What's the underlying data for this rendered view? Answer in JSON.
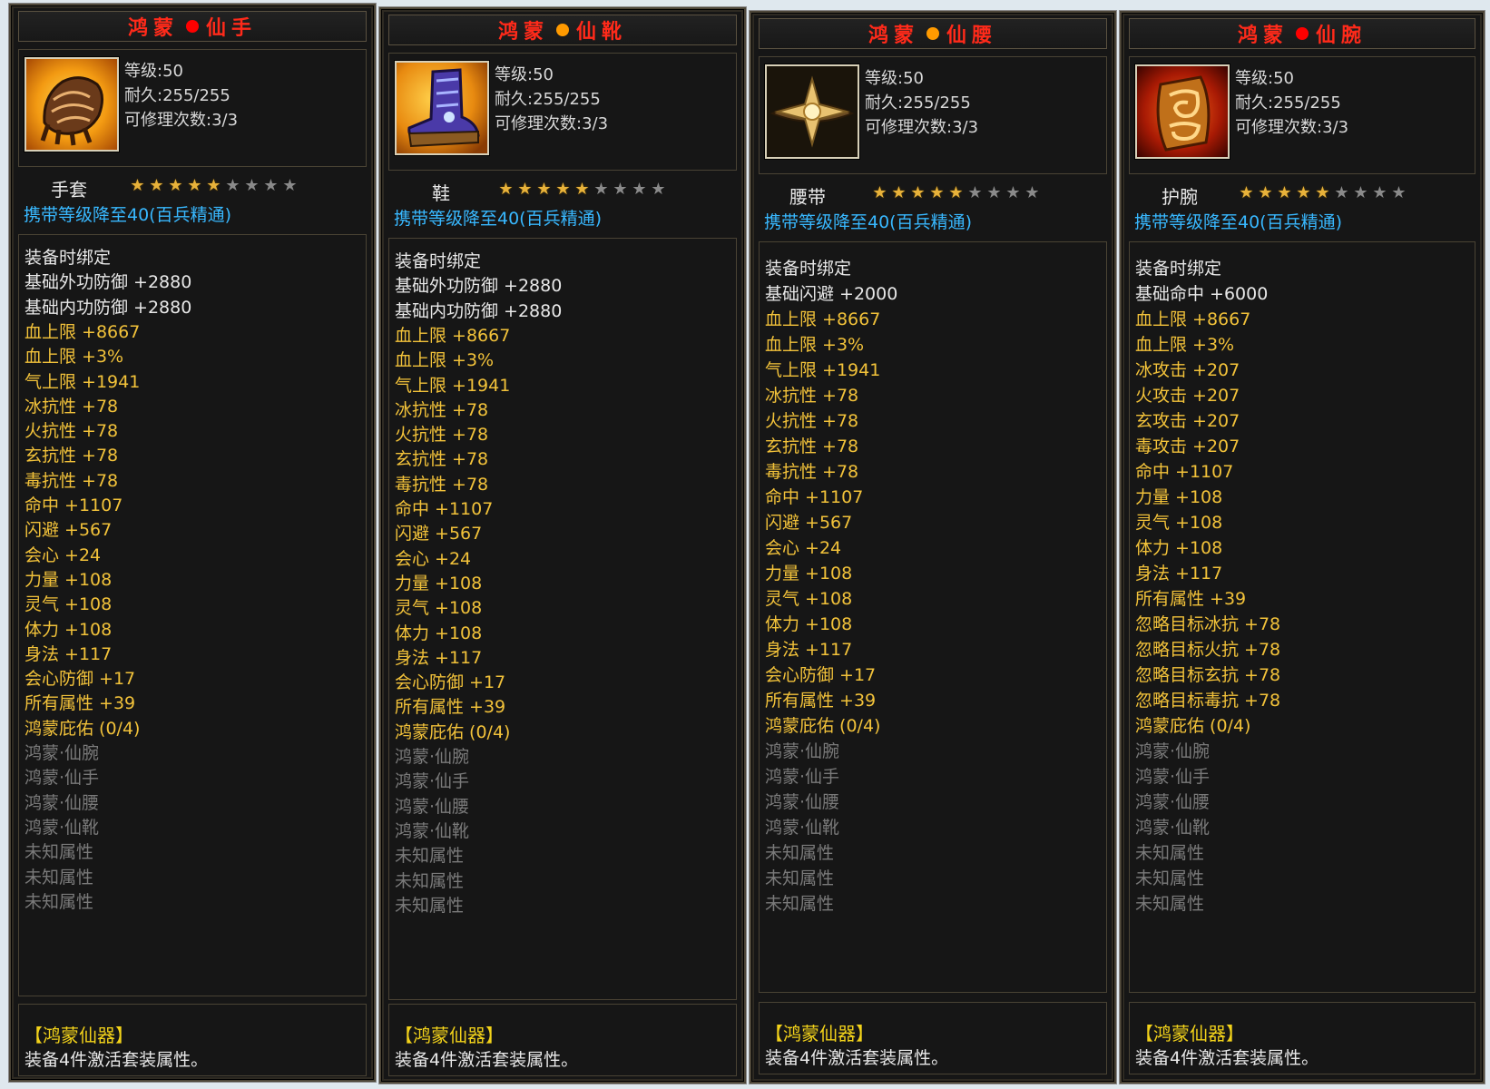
{
  "colors": {
    "title": "#ff2a1a",
    "dot": "#ff0000",
    "dot_boots": "#ff9a00",
    "carry": "#38b8ff",
    "gold": "#f2c23a",
    "inactive": "#7a7a7a",
    "star_on": "#e8b23a",
    "star_off": "#8a8a8a"
  },
  "stars_total": 9,
  "panels": [
    {
      "title_left": "鸿蒙",
      "title_right": "仙手",
      "icon": "gauntlet-icon",
      "level": "等级:50",
      "durability": "耐久:255/255",
      "repair": "可修理次数:3/3",
      "type": "手套",
      "stars_filled": 5,
      "carry": "携带等级降至40(百兵精通)",
      "bind": "装备时绑定",
      "stats": [
        {
          "t": "基础外功防御 +2880",
          "c": "white"
        },
        {
          "t": "基础内功防御 +2880",
          "c": "white"
        },
        {
          "t": "血上限 +8667",
          "c": "gold"
        },
        {
          "t": "血上限 +3%",
          "c": "gold"
        },
        {
          "t": "气上限 +1941",
          "c": "gold"
        },
        {
          "t": "冰抗性 +78",
          "c": "gold"
        },
        {
          "t": "火抗性 +78",
          "c": "gold"
        },
        {
          "t": "玄抗性 +78",
          "c": "gold"
        },
        {
          "t": "毒抗性 +78",
          "c": "gold"
        },
        {
          "t": "命中 +1107",
          "c": "gold"
        },
        {
          "t": "闪避 +567",
          "c": "gold"
        },
        {
          "t": "会心 +24",
          "c": "gold"
        },
        {
          "t": "力量 +108",
          "c": "gold"
        },
        {
          "t": "灵气 +108",
          "c": "gold"
        },
        {
          "t": "体力 +108",
          "c": "gold"
        },
        {
          "t": "身法 +117",
          "c": "gold"
        },
        {
          "t": "会心防御 +17",
          "c": "gold"
        },
        {
          "t": "所有属性 +39",
          "c": "gold"
        },
        {
          "t": "鸿蒙庇佑 (0/4)",
          "c": "gold"
        },
        {
          "t": "鸿蒙·仙腕",
          "c": "gray"
        },
        {
          "t": "鸿蒙·仙手",
          "c": "gray"
        },
        {
          "t": "鸿蒙·仙腰",
          "c": "gray"
        },
        {
          "t": "鸿蒙·仙靴",
          "c": "gray"
        },
        {
          "t": "未知属性",
          "c": "gray"
        },
        {
          "t": "未知属性",
          "c": "gray"
        },
        {
          "t": "未知属性",
          "c": "gray"
        }
      ],
      "set_name": "【鸿蒙仙器】",
      "set_desc": "装备4件激活套装属性。"
    },
    {
      "title_left": "鸿蒙",
      "title_right": "仙靴",
      "icon": "boots-icon",
      "level": "等级:50",
      "durability": "耐久:255/255",
      "repair": "可修理次数:3/3",
      "type": "鞋",
      "stars_filled": 5,
      "carry": "携带等级降至40(百兵精通)",
      "bind": "装备时绑定",
      "stats": [
        {
          "t": "基础外功防御 +2880",
          "c": "white"
        },
        {
          "t": "基础内功防御 +2880",
          "c": "white"
        },
        {
          "t": "血上限 +8667",
          "c": "gold"
        },
        {
          "t": "血上限 +3%",
          "c": "gold"
        },
        {
          "t": "气上限 +1941",
          "c": "gold"
        },
        {
          "t": "冰抗性 +78",
          "c": "gold"
        },
        {
          "t": "火抗性 +78",
          "c": "gold"
        },
        {
          "t": "玄抗性 +78",
          "c": "gold"
        },
        {
          "t": "毒抗性 +78",
          "c": "gold"
        },
        {
          "t": "命中 +1107",
          "c": "gold"
        },
        {
          "t": "闪避 +567",
          "c": "gold"
        },
        {
          "t": "会心 +24",
          "c": "gold"
        },
        {
          "t": "力量 +108",
          "c": "gold"
        },
        {
          "t": "灵气 +108",
          "c": "gold"
        },
        {
          "t": "体力 +108",
          "c": "gold"
        },
        {
          "t": "身法 +117",
          "c": "gold"
        },
        {
          "t": "会心防御 +17",
          "c": "gold"
        },
        {
          "t": "所有属性 +39",
          "c": "gold"
        },
        {
          "t": "鸿蒙庇佑 (0/4)",
          "c": "gold"
        },
        {
          "t": "鸿蒙·仙腕",
          "c": "gray"
        },
        {
          "t": "鸿蒙·仙手",
          "c": "gray"
        },
        {
          "t": "鸿蒙·仙腰",
          "c": "gray"
        },
        {
          "t": "鸿蒙·仙靴",
          "c": "gray"
        },
        {
          "t": "未知属性",
          "c": "gray"
        },
        {
          "t": "未知属性",
          "c": "gray"
        },
        {
          "t": "未知属性",
          "c": "gray"
        }
      ],
      "set_name": "【鸿蒙仙器】",
      "set_desc": "装备4件激活套装属性。"
    },
    {
      "title_left": "鸿蒙",
      "title_right": "仙腰",
      "icon": "belt-icon",
      "level": "等级:50",
      "durability": "耐久:255/255",
      "repair": "可修理次数:3/3",
      "type": "腰带",
      "stars_filled": 5,
      "carry": "携带等级降至40(百兵精通)",
      "bind": "装备时绑定",
      "stats": [
        {
          "t": "基础闪避 +2000",
          "c": "white"
        },
        {
          "t": "血上限 +8667",
          "c": "gold"
        },
        {
          "t": "血上限 +3%",
          "c": "gold"
        },
        {
          "t": "气上限 +1941",
          "c": "gold"
        },
        {
          "t": "冰抗性 +78",
          "c": "gold"
        },
        {
          "t": "火抗性 +78",
          "c": "gold"
        },
        {
          "t": "玄抗性 +78",
          "c": "gold"
        },
        {
          "t": "毒抗性 +78",
          "c": "gold"
        },
        {
          "t": "命中 +1107",
          "c": "gold"
        },
        {
          "t": "闪避 +567",
          "c": "gold"
        },
        {
          "t": "会心 +24",
          "c": "gold"
        },
        {
          "t": "力量 +108",
          "c": "gold"
        },
        {
          "t": "灵气 +108",
          "c": "gold"
        },
        {
          "t": "体力 +108",
          "c": "gold"
        },
        {
          "t": "身法 +117",
          "c": "gold"
        },
        {
          "t": "会心防御 +17",
          "c": "gold"
        },
        {
          "t": "所有属性 +39",
          "c": "gold"
        },
        {
          "t": "鸿蒙庇佑 (0/4)",
          "c": "gold"
        },
        {
          "t": "鸿蒙·仙腕",
          "c": "gray"
        },
        {
          "t": "鸿蒙·仙手",
          "c": "gray"
        },
        {
          "t": "鸿蒙·仙腰",
          "c": "gray"
        },
        {
          "t": "鸿蒙·仙靴",
          "c": "gray"
        },
        {
          "t": "未知属性",
          "c": "gray"
        },
        {
          "t": "未知属性",
          "c": "gray"
        },
        {
          "t": "未知属性",
          "c": "gray"
        }
      ],
      "set_name": "【鸿蒙仙器】",
      "set_desc": "装备4件激活套装属性。"
    },
    {
      "title_left": "鸿蒙",
      "title_right": "仙腕",
      "icon": "bracer-icon",
      "level": "等级:50",
      "durability": "耐久:255/255",
      "repair": "可修理次数:3/3",
      "type": "护腕",
      "stars_filled": 5,
      "carry": "携带等级降至40(百兵精通)",
      "bind": "装备时绑定",
      "stats": [
        {
          "t": "基础命中 +6000",
          "c": "white"
        },
        {
          "t": "血上限 +8667",
          "c": "gold"
        },
        {
          "t": "血上限 +3%",
          "c": "gold"
        },
        {
          "t": "冰攻击 +207",
          "c": "gold"
        },
        {
          "t": "火攻击 +207",
          "c": "gold"
        },
        {
          "t": "玄攻击 +207",
          "c": "gold"
        },
        {
          "t": "毒攻击 +207",
          "c": "gold"
        },
        {
          "t": "命中 +1107",
          "c": "gold"
        },
        {
          "t": "力量 +108",
          "c": "gold"
        },
        {
          "t": "灵气 +108",
          "c": "gold"
        },
        {
          "t": "体力 +108",
          "c": "gold"
        },
        {
          "t": "身法 +117",
          "c": "gold"
        },
        {
          "t": "所有属性 +39",
          "c": "gold"
        },
        {
          "t": "忽略目标冰抗 +78",
          "c": "gold"
        },
        {
          "t": "忽略目标火抗 +78",
          "c": "gold"
        },
        {
          "t": "忽略目标玄抗 +78",
          "c": "gold"
        },
        {
          "t": "忽略目标毒抗 +78",
          "c": "gold"
        },
        {
          "t": "鸿蒙庇佑 (0/4)",
          "c": "gold"
        },
        {
          "t": "鸿蒙·仙腕",
          "c": "gray"
        },
        {
          "t": "鸿蒙·仙手",
          "c": "gray"
        },
        {
          "t": "鸿蒙·仙腰",
          "c": "gray"
        },
        {
          "t": "鸿蒙·仙靴",
          "c": "gray"
        },
        {
          "t": "未知属性",
          "c": "gray"
        },
        {
          "t": "未知属性",
          "c": "gray"
        },
        {
          "t": "未知属性",
          "c": "gray"
        }
      ],
      "set_name": "【鸿蒙仙器】",
      "set_desc": "装备4件激活套装属性。"
    }
  ]
}
